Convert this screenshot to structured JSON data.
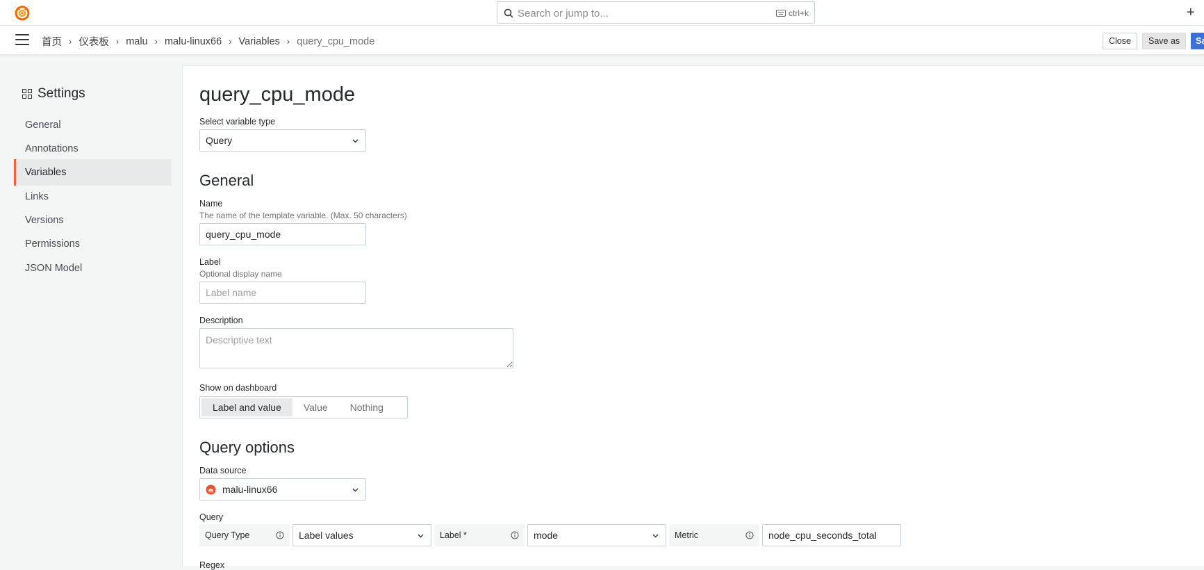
{
  "search": {
    "placeholder": "Search or jump to...",
    "shortcut": "ctrl+k"
  },
  "breadcrumb": [
    "首页",
    "仪表板",
    "malu",
    "malu-linux66",
    "Variables",
    "query_cpu_mode"
  ],
  "toolbar": {
    "close_label": "Close",
    "saveas_label": "Save as",
    "save_label": "Save dashboard"
  },
  "sidebar": {
    "title": "Settings",
    "items": [
      {
        "label": "General",
        "active": false
      },
      {
        "label": "Annotations",
        "active": false
      },
      {
        "label": "Variables",
        "active": true
      },
      {
        "label": "Links",
        "active": false
      },
      {
        "label": "Versions",
        "active": false
      },
      {
        "label": "Permissions",
        "active": false
      },
      {
        "label": "JSON Model",
        "active": false
      }
    ]
  },
  "main": {
    "title": "query_cpu_mode",
    "variable_type": {
      "label": "Select variable type",
      "value": "Query"
    },
    "general": {
      "heading": "General",
      "name": {
        "label": "Name",
        "description": "The name of the template variable. (Max. 50 characters)",
        "value": "query_cpu_mode"
      },
      "label": {
        "label": "Label",
        "description": "Optional display name",
        "placeholder": "Label name"
      },
      "description": {
        "label": "Description",
        "placeholder": "Descriptive text"
      },
      "show_on_dashboard": {
        "label": "Show on dashboard",
        "options": [
          "Label and value",
          "Value",
          "Nothing"
        ],
        "selected": "Label and value"
      }
    },
    "query_options": {
      "heading": "Query options",
      "data_source": {
        "label": "Data source",
        "value": "malu-linux66"
      },
      "query": {
        "label": "Query",
        "query_type_label": "Query Type",
        "query_type_value": "Label values",
        "label_field_label": "Label *",
        "label_field_value": "mode",
        "metric_label": "Metric",
        "metric_value": "node_cpu_seconds_total"
      },
      "regex_label": "Regex"
    }
  },
  "colors": {
    "accent": "#f55f3e",
    "primary_button": "#3d71d9"
  }
}
